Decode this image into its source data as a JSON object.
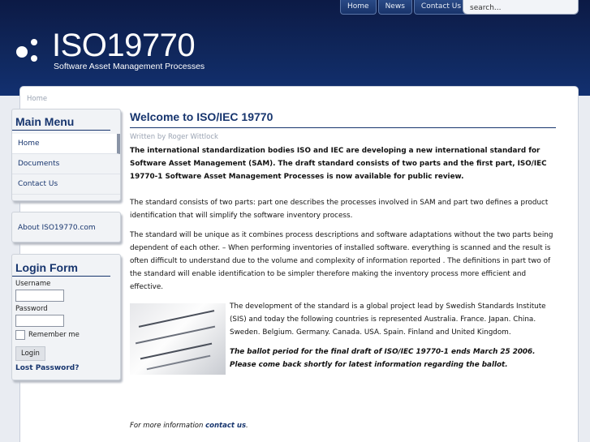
{
  "header": {
    "nav": [
      "Home",
      "News",
      "Contact Us"
    ],
    "search_placeholder": "search...",
    "logo_title": "ISO19770",
    "logo_tagline": "Software Asset Management Processes"
  },
  "breadcrumb": "Home",
  "main_menu": {
    "title": "Main Menu",
    "items": [
      "Home",
      "Documents",
      "Contact Us"
    ]
  },
  "about": "About ISO19770.com",
  "login": {
    "title": "Login Form",
    "username_label": "Username",
    "password_label": "Password",
    "remember_label": "Remember me",
    "button": "Login",
    "lost_password": "Lost Password?"
  },
  "article": {
    "title": "Welcome to ISO/IEC 19770",
    "byline": "Written by Roger Wittlock",
    "lead": "The international standardization bodies ISO and IEC are developing a new international standard for Software Asset Management (SAM). The draft standard consists of two parts and the first part, ISO/IEC 19770-1 Software Asset Management Processes is now available for public review.",
    "p1": "The standard consists of two parts: part one describes the processes involved in SAM and part two defines a product identification that will simplify the software inventory process.",
    "p2": "The standard will be unique as it combines process descriptions and software adaptations without the two parts being dependent of each other. – When performing inventories of installed software. everything is scanned and the result is often difficult to understand due to the volume and complexity of information reported . The definitions in part two of the standard will enable identification to be simpler therefore making the inventory process more efficient and effective.",
    "p3": "The development of the standard is a global project lead by Swedish Standards Institute (SIS) and today the following countries is represented Australia. France. Japan. China. Sweden. Belgium. Germany. Canada. USA. Spain. Finland and United Kingdom.",
    "ballot": "The ballot period for the final draft of ISO/IEC 19770-1 ends March 25 2006. Please come back shortly for latest information regarding the ballot.",
    "more_prefix": "For more information",
    "more_link": "contact us",
    "more_suffix": "."
  }
}
